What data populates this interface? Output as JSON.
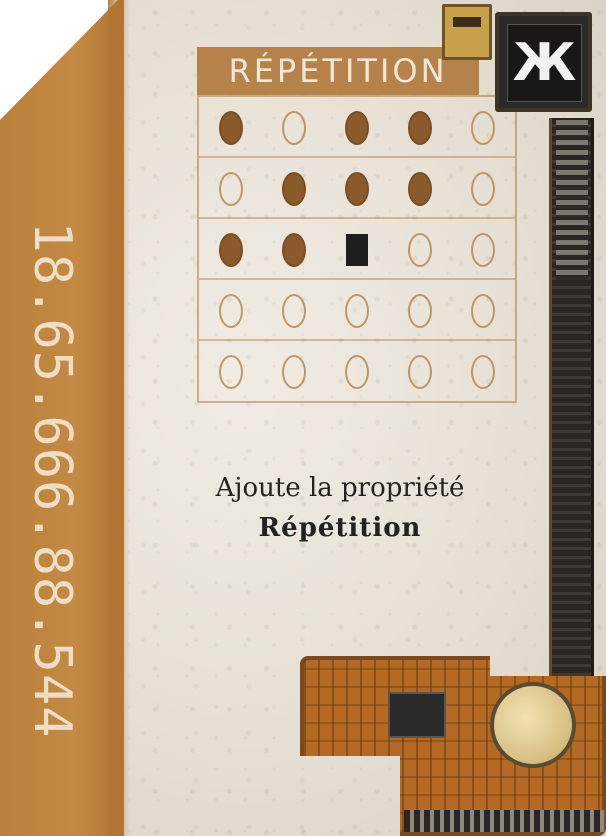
{
  "card": {
    "title": "RÉPÉTITION",
    "serial": "18.65.666.88.544",
    "description_line1": "Ajoute la propriété",
    "description_line2": "Répétition",
    "chip_glyph": "Ж"
  },
  "grid": {
    "rows": 5,
    "cols": 5,
    "cells": [
      [
        "filled",
        "empty",
        "filled",
        "filled",
        "empty"
      ],
      [
        "empty",
        "filled",
        "filled",
        "filled",
        "empty"
      ],
      [
        "filled",
        "filled",
        "marker",
        "empty",
        "empty"
      ],
      [
        "empty",
        "empty",
        "empty",
        "empty",
        "empty"
      ],
      [
        "empty",
        "empty",
        "empty",
        "empty",
        "empty"
      ]
    ]
  },
  "colors": {
    "accent": "#b27b3e",
    "paper": "#e8e2d6",
    "filled": "#8a5a2b",
    "marker": "#1f1e1c"
  }
}
